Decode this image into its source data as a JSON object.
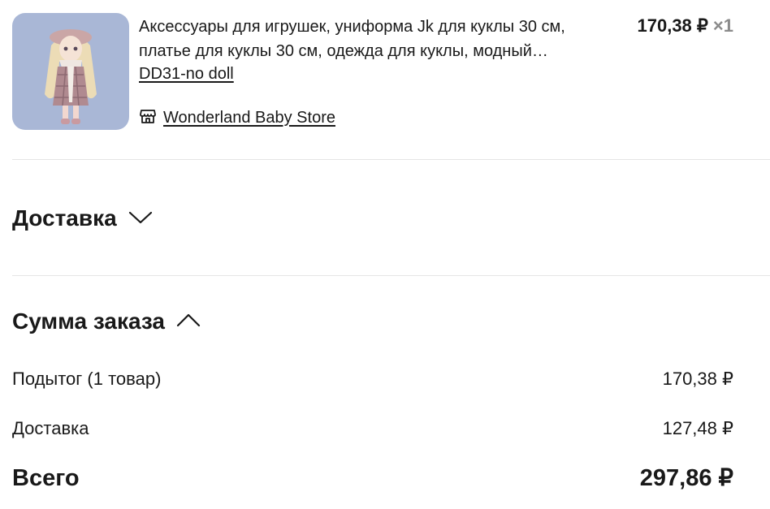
{
  "product": {
    "title": "Аксессуары для игрушек, униформа Jk для куклы 30 см, платье для куклы 30 см, одежда для куклы, модный костюм",
    "variant": "DD31-no doll",
    "store_name": "Wonderland Baby Store",
    "price": "170,38 ₽",
    "quantity": "×1",
    "image_icon": "doll-product-image"
  },
  "delivery_section": {
    "title": "Доставка",
    "icon": "chevron-down-icon"
  },
  "summary": {
    "title": "Сумма заказа",
    "icon": "chevron-up-icon",
    "rows": [
      {
        "label": "Подытог (1 товар)",
        "value": "170,38 ₽"
      },
      {
        "label": "Доставка",
        "value": "127,48 ₽"
      }
    ],
    "total_label": "Всего",
    "total_value": "297,86 ₽"
  }
}
